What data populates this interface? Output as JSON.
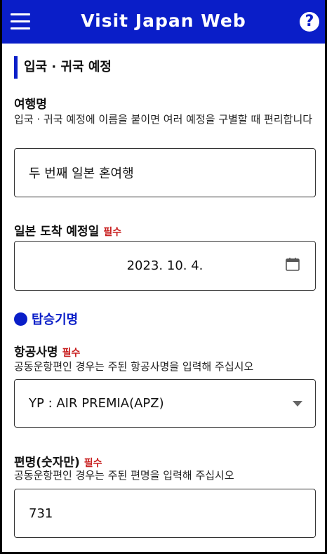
{
  "header": {
    "title": "Visit Japan Web",
    "help_glyph": "?"
  },
  "section": {
    "title": "입국 · 귀국 예정"
  },
  "trip_name": {
    "label": "여행명",
    "help": "입국 · 귀국 예정에 이름을 붙이면 여러 예정을 구별할 때 편리합니다",
    "value": "두 번째 일본 혼여행"
  },
  "arrival_date": {
    "label": "일본 도착 예정일",
    "required": "필수",
    "value": "2023. 10. 4."
  },
  "flight": {
    "title": "탑승기명"
  },
  "airline": {
    "label": "항공사명",
    "required": "필수",
    "help": "공동운항편인 경우는 주된 항공사명을 입력해 주십시오",
    "value": "YP : AIR PREMIA(APZ)"
  },
  "flight_no": {
    "label": "편명(숫자만)",
    "required": "필수",
    "help": "공동운항편인 경우는 주된 편명을 입력해 주십시오",
    "value": "731"
  },
  "colors": {
    "brand": "#0a1ec8",
    "required": "#c81e1e"
  },
  "icons": [
    "menu-icon",
    "help-icon",
    "calendar-icon",
    "dropdown-caret-icon"
  ]
}
